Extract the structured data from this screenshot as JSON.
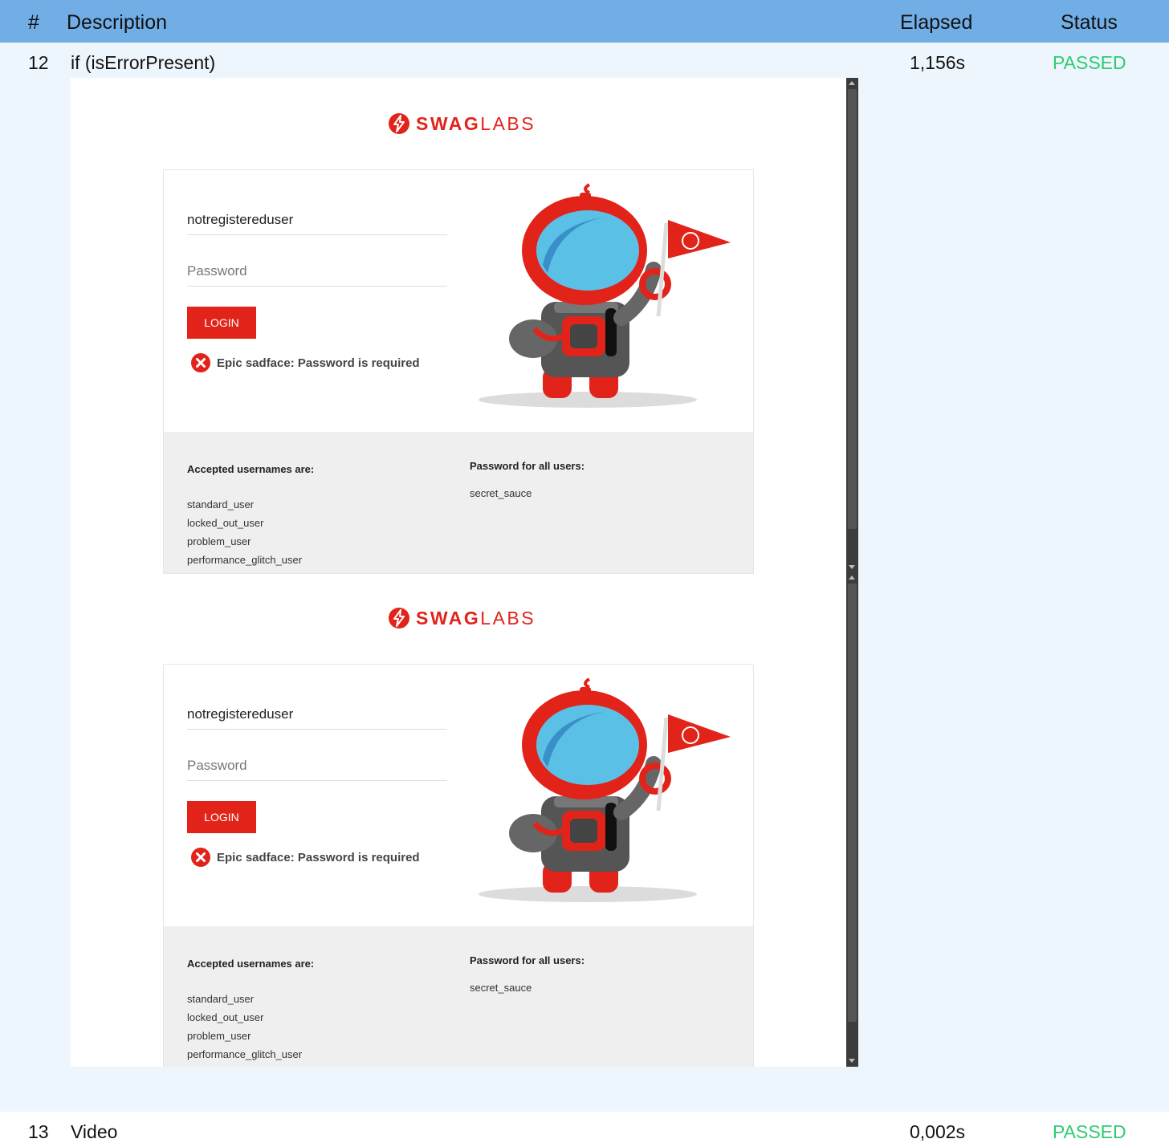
{
  "table": {
    "headers": {
      "num": "#",
      "description": "Description",
      "elapsed": "Elapsed",
      "status": "Status"
    },
    "rows": [
      {
        "num": "12",
        "description": "if (isErrorPresent)",
        "elapsed": "1,156s",
        "status": "PASSED"
      },
      {
        "num": "13",
        "description": "Video",
        "elapsed": "0,002s",
        "status": "PASSED"
      }
    ]
  },
  "screenshot": {
    "logo": {
      "bold": "SWAG",
      "light": "LABS"
    },
    "username_value": "notregistereduser",
    "password_placeholder": "Password",
    "login_label": "LOGIN",
    "error_message": "Epic sadface: Password is required",
    "usernames_title": "Accepted usernames are:",
    "usernames": [
      "standard_user",
      "locked_out_user",
      "problem_user",
      "performance_glitch_user"
    ],
    "password_title": "Password for all users:",
    "password_value": "secret_sauce"
  },
  "colors": {
    "header": "#72aee6",
    "row_bg": "#eef6fd",
    "passed": "#2ecc71",
    "brand_red": "#e2231a"
  }
}
